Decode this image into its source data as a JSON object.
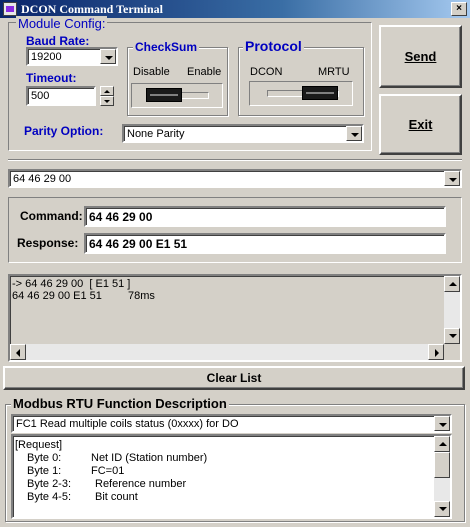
{
  "window": {
    "title": "DCON Command Terminal",
    "close_glyph": "×",
    "icon": "app-icon"
  },
  "config": {
    "group_title": "Module Config:",
    "baud_label": "Baud Rate:",
    "baud_value": "19200",
    "timeout_label": "Timeout:",
    "timeout_value": "500",
    "parity_label": "Parity Option:",
    "parity_value": "None Parity"
  },
  "checksum": {
    "title": "CheckSum",
    "left_label": "Disable",
    "right_label": "Enable",
    "state": "Disable"
  },
  "protocol": {
    "title": "Protocol",
    "left_label": "DCON",
    "right_label": "MRTU",
    "state": "MRTU"
  },
  "buttons": {
    "send": "Send",
    "exit": "Exit",
    "clear_list": "Clear List"
  },
  "history_select": {
    "value": "64 46 29 00"
  },
  "command": {
    "label": "Command:",
    "value": "64 46 29 00"
  },
  "response": {
    "label": "Response:",
    "value": "64 46 29 00 E1 51"
  },
  "log": {
    "lines": [
      {
        "text": "-> 64 46 29 00  [ E1 51 ]",
        "time": ""
      },
      {
        "text": "64 46 29 00 E1 51",
        "time": "78ms"
      }
    ]
  },
  "modbus": {
    "title": "Modbus RTU Function Description",
    "function_value": "FC1  Read multiple coils status (0xxxx)  for DO",
    "description": {
      "header": "[Request]",
      "rows": [
        {
          "key": "Byte 0:",
          "value": "Net ID (Station number)"
        },
        {
          "key": "Byte 1:",
          "value": "FC=01"
        },
        {
          "key": "Byte 2-3:",
          "value": "Reference number"
        },
        {
          "key": "Byte 4-5:",
          "value": "Bit count"
        }
      ]
    }
  },
  "colors": {
    "face": "#d4d0c8",
    "title_start": "#0a246a",
    "label_blue": "#0000c0"
  }
}
